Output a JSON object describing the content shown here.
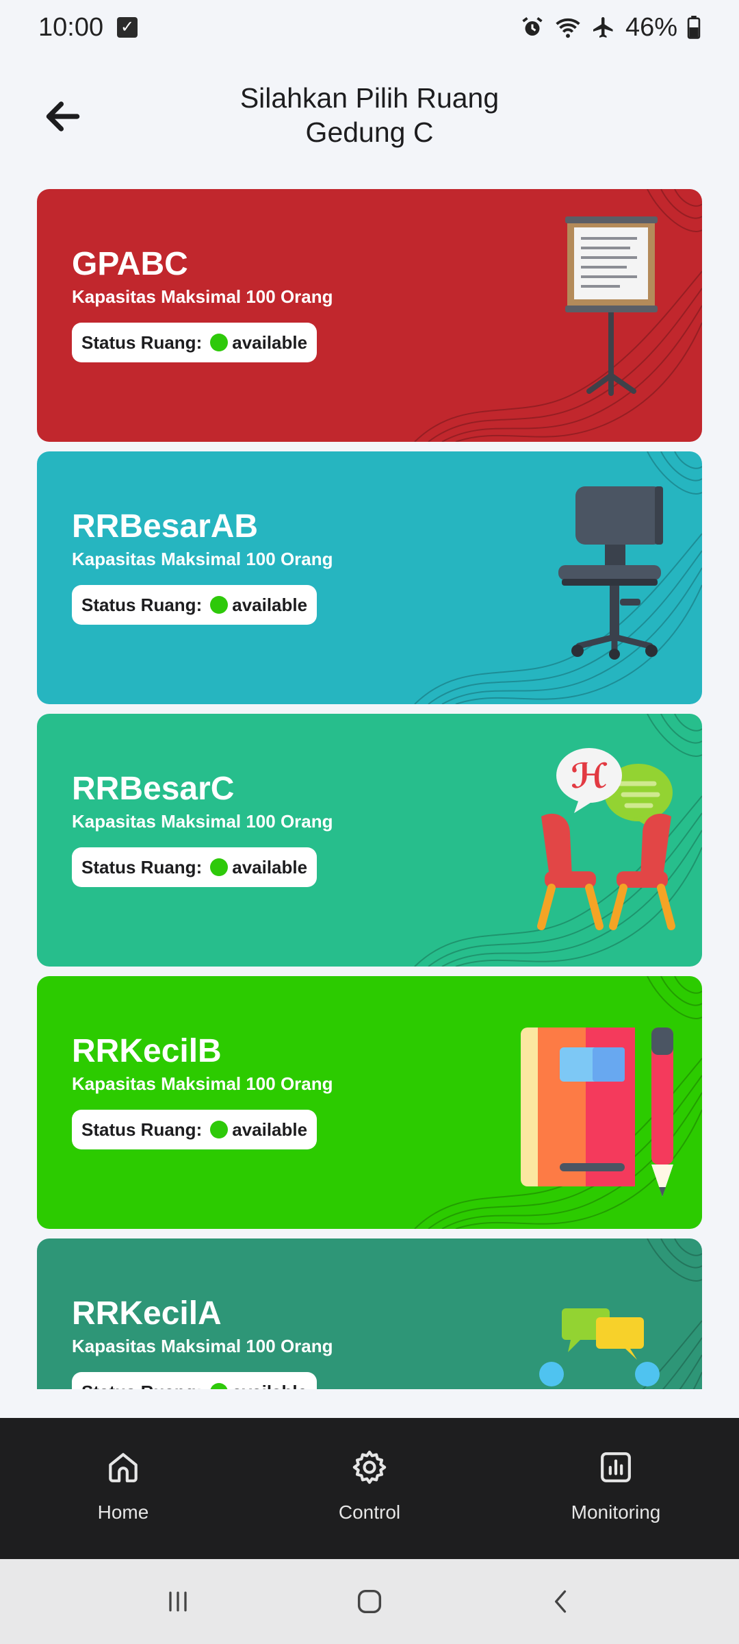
{
  "status_bar": {
    "time": "10:00",
    "battery": "46%",
    "icons": [
      "checkbox-notification-icon",
      "alarm-icon",
      "wifi-icon",
      "airplane-icon",
      "battery-icon"
    ]
  },
  "header": {
    "title_line1": "Silahkan Pilih Ruang",
    "title_line2": "Gedung C",
    "back_icon": "arrow-left-icon"
  },
  "rooms": [
    {
      "name": "GPABC",
      "capacity": "Kapasitas Maksimal 100 Orang",
      "status_label": "Status Ruang:",
      "status": "available",
      "color": "#c1272d",
      "illustration": "presentation-board-icon"
    },
    {
      "name": "RRBesarAB",
      "capacity": "Kapasitas Maksimal 100 Orang",
      "status_label": "Status Ruang:",
      "status": "available",
      "color": "#26b5c0",
      "illustration": "office-chair-icon"
    },
    {
      "name": "RRBesarC",
      "capacity": "Kapasitas Maksimal 100 Orang",
      "status_label": "Status Ruang:",
      "status": "available",
      "color": "#27be8c",
      "illustration": "chairs-conversation-icon"
    },
    {
      "name": "RRKecilB",
      "capacity": "Kapasitas Maksimal 100 Orang",
      "status_label": "Status Ruang:",
      "status": "available",
      "color": "#2ccb00",
      "illustration": "notebook-pencil-icon"
    },
    {
      "name": "RRKecilA",
      "capacity": "Kapasitas Maksimal 100 Orang",
      "status_label": "Status Ruang:",
      "status": "available",
      "color": "#2e9677",
      "illustration": "people-chat-icon"
    }
  ],
  "status_dot_color": "#2ec90a",
  "bottom_nav": [
    {
      "label": "Home",
      "icon": "home-icon"
    },
    {
      "label": "Control",
      "icon": "gear-icon"
    },
    {
      "label": "Monitoring",
      "icon": "bar-chart-icon"
    }
  ],
  "system_nav": [
    "recents-icon",
    "home-circle-icon",
    "back-chevron-icon"
  ]
}
